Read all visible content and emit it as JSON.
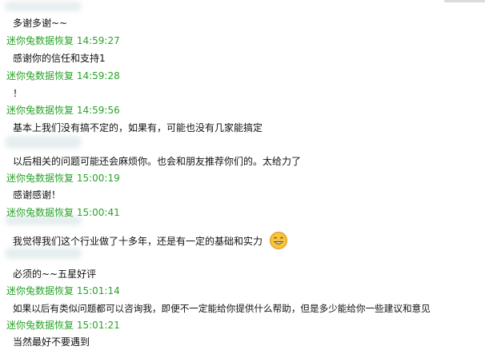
{
  "messages": [
    {
      "type": "text",
      "text": "多谢多谢~~"
    },
    {
      "type": "sender",
      "name": "迷你兔数据恢复",
      "time": "14:59:27"
    },
    {
      "type": "text",
      "text": "感谢你的信任和支持1"
    },
    {
      "type": "sender",
      "name": "迷你兔数据恢复",
      "time": "14:59:28"
    },
    {
      "type": "text",
      "text": "！"
    },
    {
      "type": "sender",
      "name": "迷你兔数据恢复",
      "time": "14:59:56"
    },
    {
      "type": "text",
      "text": "基本上我们没有搞不定的，如果有，可能也没有几家能搞定"
    },
    {
      "type": "text",
      "text": "以后相关的问题可能还会麻烦你。也会和朋友推荐你们的。太给力了"
    },
    {
      "type": "sender",
      "name": "迷你兔数据恢复",
      "time": "15:00:19"
    },
    {
      "type": "text",
      "text": "感谢感谢！"
    },
    {
      "type": "sender",
      "name": "迷你兔数据恢复",
      "time": "15:00:41"
    },
    {
      "type": "text",
      "text": "我觉得我们这个行业做了十多年，还是有一定的基础和实力",
      "emoji": "grin-emoji"
    },
    {
      "type": "text",
      "text": "必须的~~五星好评"
    },
    {
      "type": "sender",
      "name": "迷你兔数据恢复",
      "time": "15:01:14"
    },
    {
      "type": "text",
      "text": "如果以后有类似问题都可以咨询我，即便不一定能给你提供什么帮助，但是多少能给你一些建议和意见"
    },
    {
      "type": "sender",
      "name": "迷你兔数据恢复",
      "time": "15:01:21"
    },
    {
      "type": "text",
      "text": "当然最好不要遇到"
    }
  ]
}
